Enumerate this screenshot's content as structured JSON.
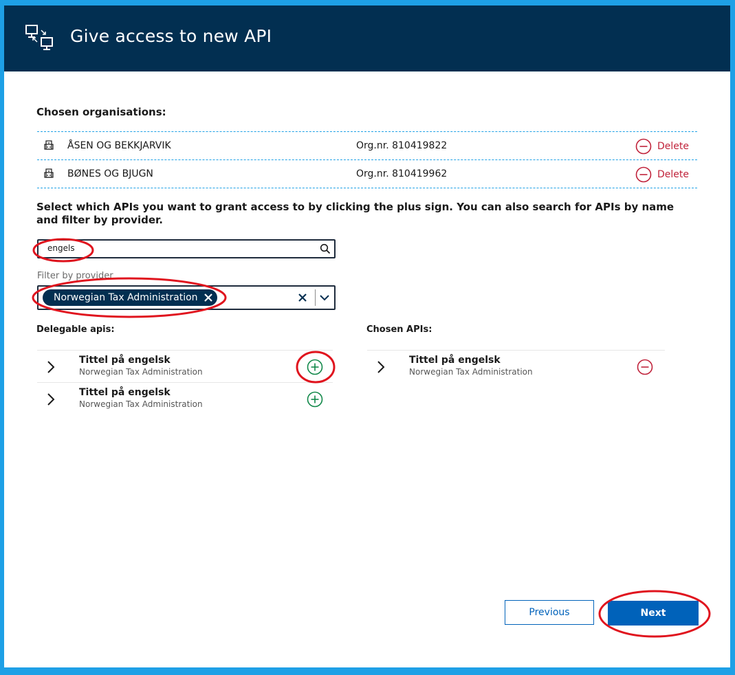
{
  "header": {
    "title": "Give access to new API"
  },
  "organisations": {
    "title": "Chosen organisations:",
    "delete_label": "Delete",
    "items": [
      {
        "name": "ÅSEN OG BEKKJARVIK",
        "orgnr": "Org.nr. 810419822"
      },
      {
        "name": "BØNES OG BJUGN",
        "orgnr": "Org.nr. 810419962"
      }
    ]
  },
  "instruction": "Select which APIs you want to grant access to by clicking the plus sign. You can also search for APIs by name and filter by provider.",
  "search": {
    "value": "engels"
  },
  "filter": {
    "label": "Filter by provider",
    "selected": "Norwegian Tax Administration"
  },
  "delegable": {
    "title": "Delegable apis:",
    "items": [
      {
        "title": "Tittel på engelsk",
        "provider": "Norwegian Tax Administration"
      },
      {
        "title": "Tittel på engelsk",
        "provider": "Norwegian Tax Administration"
      }
    ]
  },
  "chosen": {
    "title": "Chosen APIs:",
    "items": [
      {
        "title": "Tittel på engelsk",
        "provider": "Norwegian Tax Administration"
      }
    ]
  },
  "buttons": {
    "previous": "Previous",
    "next": "Next"
  },
  "colors": {
    "header": "#022f51",
    "primary": "#0062ba",
    "danger": "#c0223a",
    "add": "#118849",
    "annotation": "#e0141e"
  }
}
